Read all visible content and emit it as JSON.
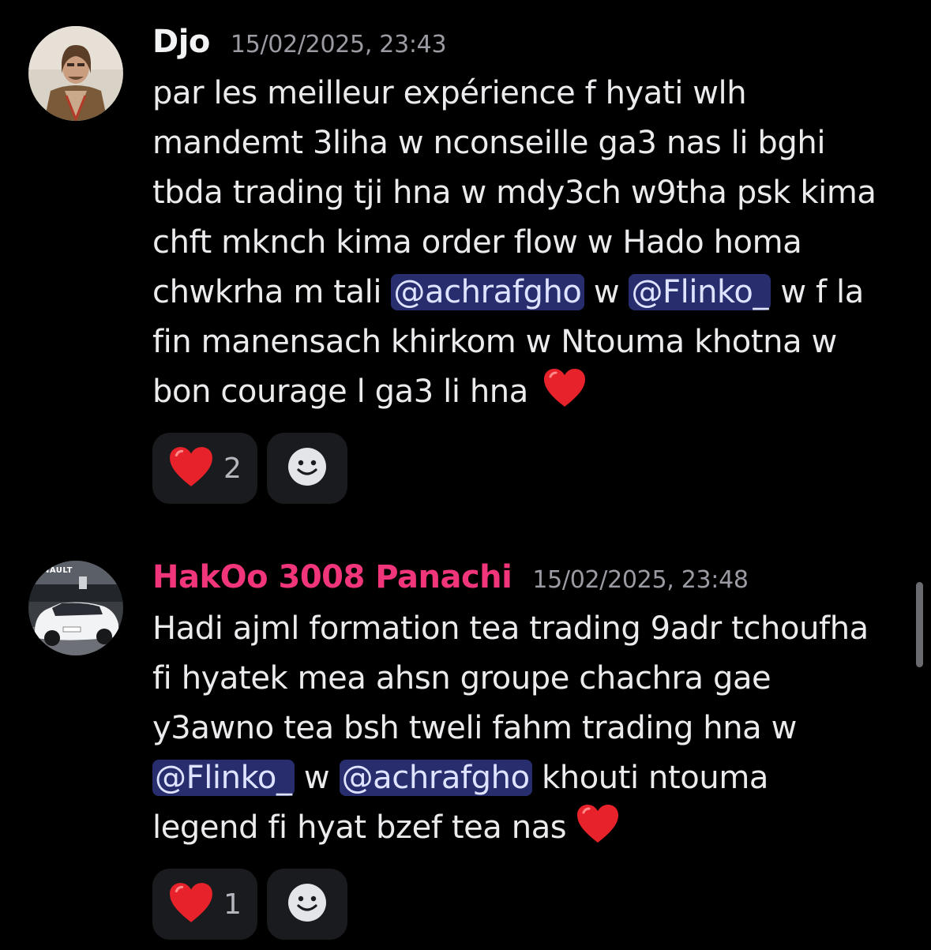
{
  "messages": [
    {
      "username": "Djo",
      "username_color": "#f2f3f5",
      "timestamp": "15/02/2025, 23:43",
      "avatar": "user-photo-avatar",
      "lines": [
        {
          "t1": "par les meilleur expérience f hyati wlh"
        },
        {
          "t1": "mandemt 3liha  w nconseille ga3 nas li bghi"
        },
        {
          "t1": "tbda trading tji hna w mdy3ch w9tha psk kima"
        },
        {
          "t1": "chft mknch kima order flow w Hado homa"
        },
        {
          "t1": "chwkrha m tali ",
          "m1": "@achrafgho",
          "t2": " w ",
          "m2": "@Flinko_",
          "t3": " w f la"
        },
        {
          "t1": "fin manensach khirkom w Ntouma khotna w"
        },
        {
          "t1": "bon courage l ga3 li hna"
        }
      ],
      "trailing_emoji": "red-heart",
      "reaction": {
        "emoji": "red-heart",
        "count": "2"
      },
      "add_reaction_icon": "smiley-add-reaction-icon"
    },
    {
      "username": "HakOo 3008 Panachi",
      "username_color": "#f0357a",
      "timestamp": "15/02/2025, 23:48",
      "avatar": "car-photo-avatar",
      "avatar_text": "NAULT",
      "lines": [
        {
          "t1": "Hadi ajml formation tea trading 9adr tchoufha"
        },
        {
          "t1": "fi hyatek mea ahsn groupe chachra gae"
        },
        {
          "t1": "y3awno tea bsh tweli fahm trading hna w"
        },
        {
          "m1": "@Flinko_",
          "t2": " w ",
          "m2": "@achrafgho",
          "t3": " khouti ntouma"
        },
        {
          "t1": "legend fi hyat bzef tea nas"
        }
      ],
      "trailing_emoji": "red-heart",
      "reaction": {
        "emoji": "red-heart",
        "count": "1"
      },
      "add_reaction_icon": "smiley-add-reaction-icon"
    }
  ],
  "colors": {
    "background": "#000000",
    "mention_bg": "#3a3f9a",
    "mention_text": "#dee3ff",
    "heart": "#e8222b",
    "reaction_bg": "#1a1b1e"
  }
}
